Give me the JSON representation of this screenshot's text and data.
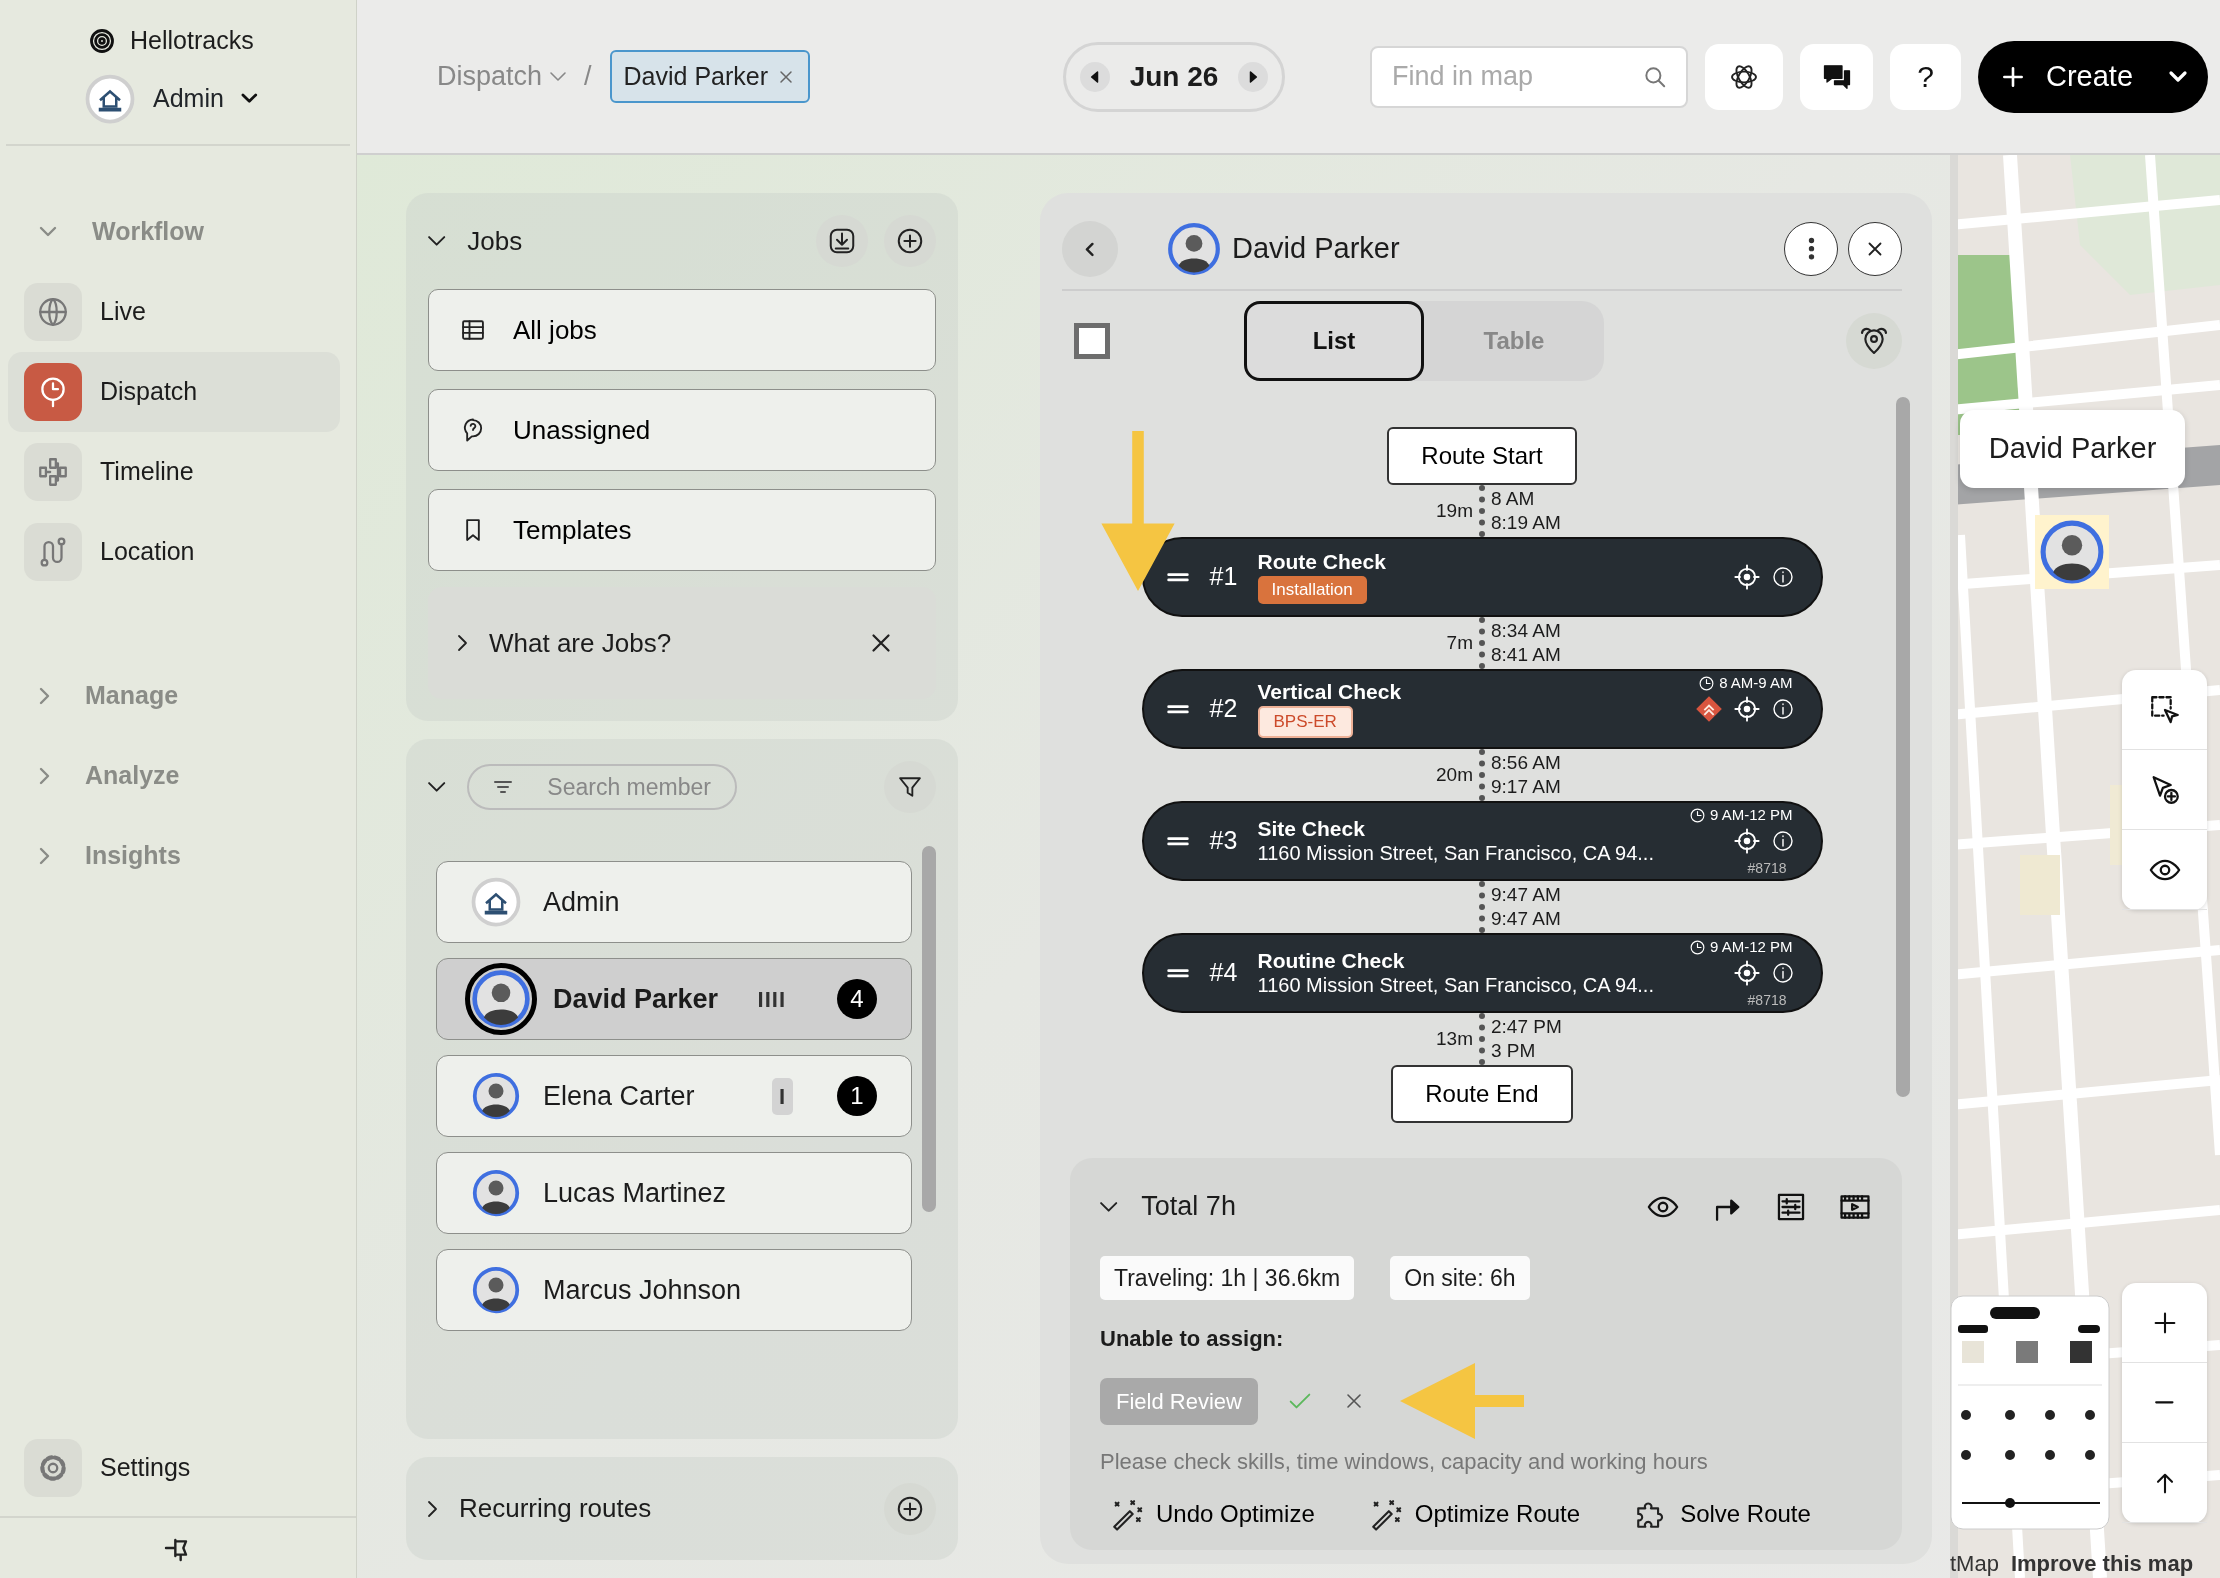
{
  "app": {
    "name": "Hellotracks",
    "account": "Admin"
  },
  "nav": [
    {
      "label": "Workflow",
      "expanded": true,
      "children": [
        {
          "label": "Live",
          "selected": false
        },
        {
          "label": "Dispatch",
          "selected": true
        },
        {
          "label": "Timeline",
          "selected": false
        },
        {
          "label": "Location",
          "selected": false
        }
      ]
    },
    {
      "label": "Manage",
      "expanded": false
    },
    {
      "label": "Analyze",
      "expanded": false
    },
    {
      "label": "Insights",
      "expanded": false
    }
  ],
  "settings": "Settings",
  "breadcrumb": {
    "section": "Dispatch",
    "separator": "/",
    "filter": "David Parker"
  },
  "date": "Jun 26",
  "search": {
    "placeholder": "Find in map"
  },
  "help": "?",
  "create": "Create",
  "jobs": {
    "title": "Jobs",
    "expanded": true,
    "items": [
      {
        "label": "All jobs"
      },
      {
        "label": "Unassigned"
      },
      {
        "label": "Templates"
      }
    ],
    "info": {
      "label": "What are Jobs?",
      "expanded": false
    }
  },
  "members": {
    "expanded": true,
    "placeholder": "Search member",
    "items": [
      {
        "name": "Admin",
        "kind": "company",
        "selected": false
      },
      {
        "name": "David Parker",
        "kind": "person",
        "selected": true,
        "tally": "IIII",
        "count": "4"
      },
      {
        "name": "Elena Carter",
        "kind": "person",
        "selected": false,
        "tally": "I",
        "count": "1"
      },
      {
        "name": "Lucas Martinez",
        "kind": "person",
        "selected": false
      },
      {
        "name": "Marcus Johnson",
        "kind": "person",
        "selected": false
      }
    ]
  },
  "recurring": {
    "title": "Recurring routes",
    "expanded": false
  },
  "route": {
    "member": "David Parker",
    "select_all": {
      "checked": false
    },
    "view_tabs": [
      {
        "label": "List",
        "selected": true
      },
      {
        "label": "Table",
        "selected": false
      }
    ],
    "start": "Route Start",
    "end": "Route End",
    "legs": [
      {
        "travel": "19m",
        "times": [
          "8 AM",
          "8:19 AM"
        ]
      },
      {
        "travel": "7m",
        "times": [
          "8:34 AM",
          "8:41 AM"
        ]
      },
      {
        "travel": "20m",
        "times": [
          "8:56 AM",
          "9:17 AM"
        ]
      },
      {
        "times": [
          "9:47 AM",
          "9:47 AM"
        ]
      },
      {
        "travel": "13m",
        "times": [
          "2:47 PM",
          "3 PM"
        ]
      }
    ],
    "stops": [
      {
        "number": "#1",
        "title": "Route Check",
        "tag": {
          "text": "Installation",
          "kind": "filled"
        },
        "priority": false
      },
      {
        "number": "#2",
        "title": "Vertical Check",
        "tag": {
          "text": "BPS-ER",
          "kind": "outlined"
        },
        "window": "8 AM-9 AM",
        "priority": true
      },
      {
        "number": "#3",
        "title": "Site Check",
        "address": "1160 Mission Street, San Francisco, CA 94...",
        "window": "9 AM-12 PM",
        "ref": "#8718",
        "priority": false
      },
      {
        "number": "#4",
        "title": "Routine Check",
        "address": "1160 Mission Street, San Francisco, CA 94...",
        "window": "9 AM-12 PM",
        "ref": "#8718",
        "priority": false
      }
    ]
  },
  "summary": {
    "expanded": true,
    "total": "Total 7h",
    "stats": [
      "Traveling: 1h | 36.6km",
      "On site: 6h"
    ],
    "unable_label": "Unable to assign:",
    "unassigned": [
      {
        "name": "Field Review"
      }
    ],
    "hint": "Please check skills, time windows, capacity and working hours",
    "actions": [
      {
        "label": "Undo Optimize",
        "kind": "wand"
      },
      {
        "label": "Optimize Route",
        "kind": "wand"
      },
      {
        "label": "Solve Route",
        "kind": "puzzle"
      }
    ]
  },
  "map": {
    "marker_label": "David Parker",
    "attribution": [
      "tMap",
      "Improve this map"
    ]
  }
}
